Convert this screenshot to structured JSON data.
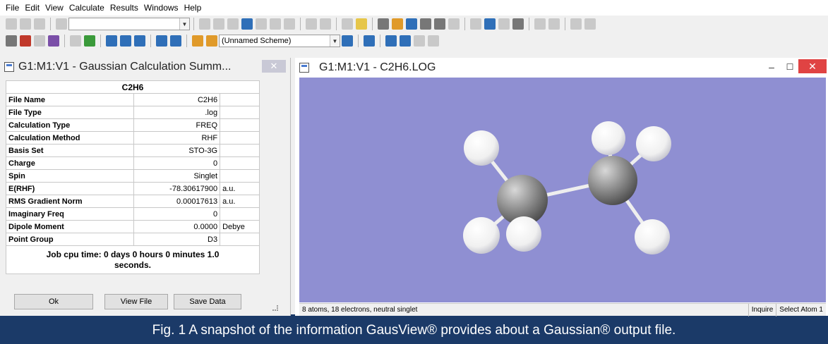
{
  "menubar": {
    "items": [
      "File",
      "Edit",
      "View",
      "Calculate",
      "Results",
      "Windows",
      "Help"
    ]
  },
  "toolbar": {
    "scheme_value": "(Unnamed Scheme)"
  },
  "summary": {
    "window_title": "G1:M1:V1 - Gaussian Calculation Summ...",
    "close_glyph": "✕",
    "table_header": "C2H6",
    "rows": [
      {
        "label": "File Name",
        "value": "C2H6",
        "unit": ""
      },
      {
        "label": "File Type",
        "value": ".log",
        "unit": ""
      },
      {
        "label": "Calculation Type",
        "value": "FREQ",
        "unit": ""
      },
      {
        "label": "Calculation Method",
        "value": "RHF",
        "unit": ""
      },
      {
        "label": "Basis Set",
        "value": "STO-3G",
        "unit": ""
      },
      {
        "label": "Charge",
        "value": "0",
        "unit": ""
      },
      {
        "label": "Spin",
        "value": "Singlet",
        "unit": ""
      },
      {
        "label": "E(RHF)",
        "value": "-78.30617900",
        "unit": "a.u."
      },
      {
        "label": "RMS Gradient Norm",
        "value": "0.00017613",
        "unit": "a.u."
      },
      {
        "label": "Imaginary Freq",
        "value": "0",
        "unit": ""
      },
      {
        "label": "Dipole Moment",
        "value": "0.0000",
        "unit": "Debye"
      },
      {
        "label": "Point Group",
        "value": "D3",
        "unit": ""
      }
    ],
    "cpu_time_line1": "Job cpu time:  0 days  0 hours  0 minutes  1.0",
    "cpu_time_line2": "seconds.",
    "buttons": {
      "ok": "Ok",
      "view_file": "View File",
      "save_data": "Save Data"
    }
  },
  "log": {
    "window_title": "G1:M1:V1 - C2H6.LOG",
    "min_glyph": "–",
    "max_glyph": "☐",
    "close_glyph": "✕",
    "viewport_color": "#8f8fd2",
    "status_text": "8 atoms, 18 electrons, neutral singlet",
    "status_inquire": "Inquire",
    "status_select": "Select Atom 1"
  },
  "molecule": {
    "carbon_color": "#8a8a8a",
    "hydrogen_color": "#f2f2f2",
    "bond_color": "#eeeeee"
  },
  "caption": "Fig. 1 A snapshot of the information GausView® provides about a Gaussian® output file."
}
